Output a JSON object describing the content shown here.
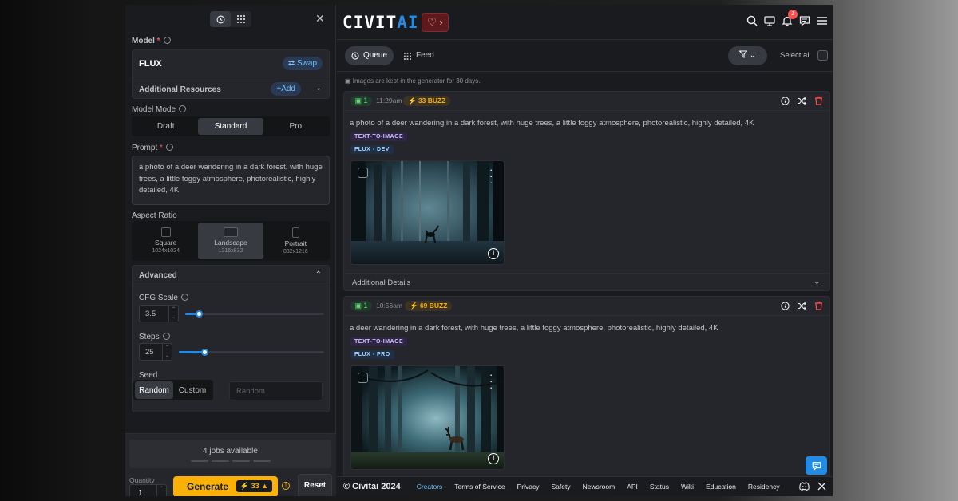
{
  "left": {
    "model_label": "Model",
    "model_name": "FLUX",
    "swap_label": "Swap",
    "additional_resources": "Additional Resources",
    "add_label": "+Add",
    "model_mode_label": "Model Mode",
    "modes": [
      "Draft",
      "Standard",
      "Pro"
    ],
    "active_mode": "Standard",
    "prompt_label": "Prompt",
    "prompt_value": "a photo of a deer wandering in a dark forest, with huge trees, a little foggy atmosphere, photorealistic, highly detailed, 4K",
    "aspect_label": "Aspect Ratio",
    "aspects": [
      {
        "name": "Square",
        "size": "1024x1024"
      },
      {
        "name": "Landscape",
        "size": "1216x832"
      },
      {
        "name": "Portrait",
        "size": "832x1216"
      }
    ],
    "active_aspect": "Landscape",
    "advanced_label": "Advanced",
    "cfg_label": "CFG Scale",
    "cfg_value": "3.5",
    "steps_label": "Steps",
    "steps_value": "25",
    "seed_label": "Seed",
    "seed_modes": [
      "Random",
      "Custom"
    ],
    "seed_placeholder": "Random",
    "jobs_available": "4 jobs available",
    "quantity_label": "Quantity",
    "quantity_value": "1",
    "generate_label": "Generate",
    "generate_cost": "33",
    "reset_label": "Reset"
  },
  "right": {
    "logo_civit": "CIVIT",
    "logo_ai": "AI",
    "notification_count": "1",
    "tabs": [
      "Queue",
      "Feed"
    ],
    "select_all": "Select all",
    "note": "Images are kept in the generator for 30 days.",
    "jobs": [
      {
        "count": "1",
        "time": "11:29am",
        "buzz": "33 BUZZ",
        "prompt": "a photo of a deer wandering in a dark forest, with huge trees, a little foggy atmosphere, photorealistic, highly detailed, 4K",
        "tags": [
          "TEXT-TO-IMAGE",
          "FLUX - DEV"
        ],
        "details_label": "Additional Details"
      },
      {
        "count": "1",
        "time": "10:56am",
        "buzz": "69 BUZZ",
        "prompt": "a deer wandering in a dark forest, with huge trees, a little foggy atmosphere, photorealistic, highly detailed, 4K",
        "tags": [
          "TEXT-TO-IMAGE",
          "FLUX - PRO"
        ]
      }
    ],
    "footer": {
      "copyright": "© Civitai 2024",
      "links": [
        "Creators",
        "Terms of Service",
        "Privacy",
        "Safety",
        "Newsroom",
        "API",
        "Status",
        "Wiki",
        "Education",
        "Residency"
      ]
    }
  },
  "colors": {
    "accent": "#228be6",
    "buzz": "#fab005",
    "danger": "#fa5252"
  }
}
